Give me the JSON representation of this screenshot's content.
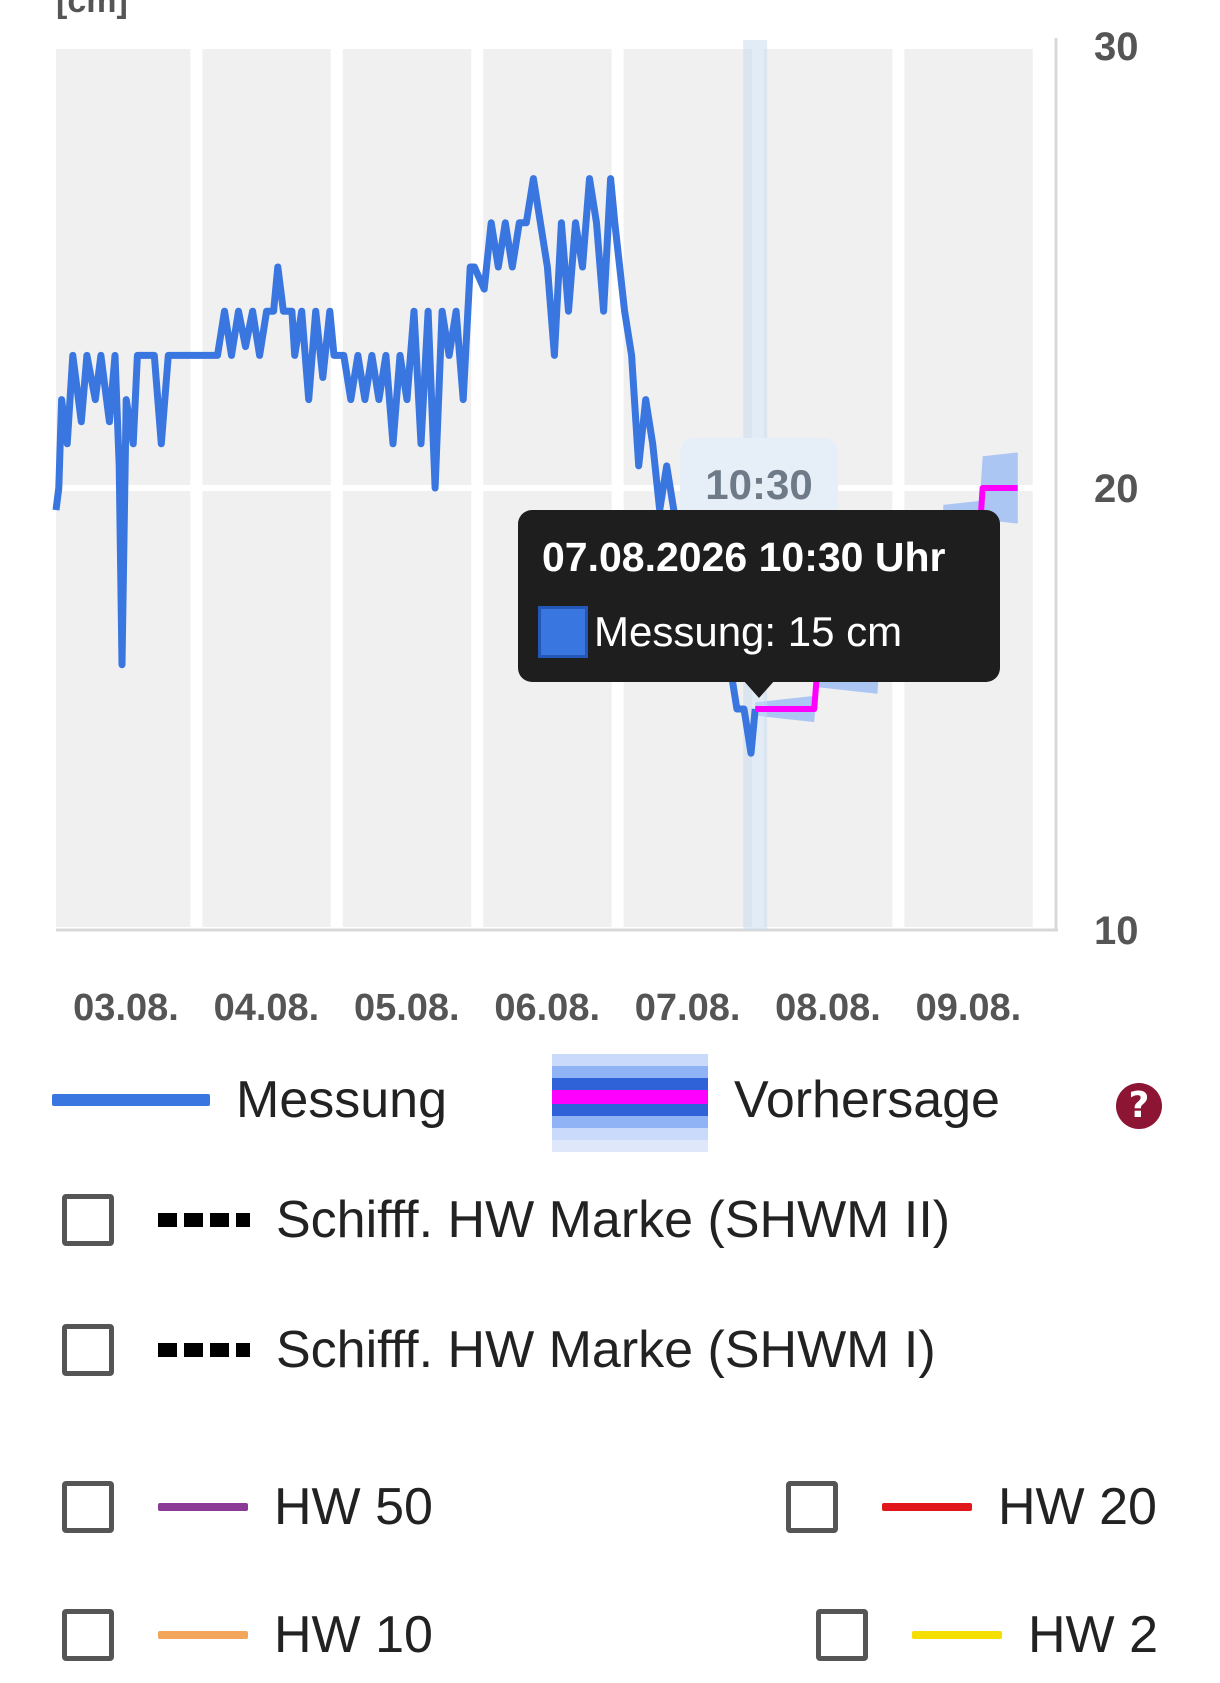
{
  "chart_data": {
    "type": "line",
    "ylabel": "[cm]",
    "ylim": [
      10,
      30
    ],
    "yticks": [
      "30",
      "20",
      "10"
    ],
    "x_range": [
      "03.08.",
      "10.08."
    ],
    "categories": [
      "03.08.",
      "04.08.",
      "05.08.",
      "06.08.",
      "07.08.",
      "08.08.",
      "09.08."
    ],
    "grid": true,
    "series": [
      {
        "name": "Messung",
        "color": "#3a76df",
        "points": [
          [
            0.0,
            19.5
          ],
          [
            0.02,
            20.0
          ],
          [
            0.04,
            22.0
          ],
          [
            0.08,
            21.0
          ],
          [
            0.12,
            23.0
          ],
          [
            0.18,
            21.5
          ],
          [
            0.22,
            23.0
          ],
          [
            0.28,
            22.0
          ],
          [
            0.32,
            23.0
          ],
          [
            0.38,
            21.5
          ],
          [
            0.42,
            23.0
          ],
          [
            0.45,
            20.5
          ],
          [
            0.47,
            16.0
          ],
          [
            0.5,
            22.0
          ],
          [
            0.55,
            21.0
          ],
          [
            0.58,
            23.0
          ],
          [
            0.65,
            23.0
          ],
          [
            0.7,
            23.0
          ],
          [
            0.75,
            21.0
          ],
          [
            0.8,
            23.0
          ],
          [
            0.85,
            23.0
          ],
          [
            0.95,
            23.0
          ],
          [
            0.98,
            23.0
          ],
          [
            1.05,
            23.0
          ],
          [
            1.15,
            23.0
          ],
          [
            1.2,
            24.0
          ],
          [
            1.25,
            23.0
          ],
          [
            1.3,
            24.0
          ],
          [
            1.35,
            23.2
          ],
          [
            1.4,
            24.0
          ],
          [
            1.45,
            23.0
          ],
          [
            1.5,
            24.0
          ],
          [
            1.55,
            24.0
          ],
          [
            1.58,
            25.0
          ],
          [
            1.62,
            24.0
          ],
          [
            1.68,
            24.0
          ],
          [
            1.7,
            23.0
          ],
          [
            1.75,
            24.0
          ],
          [
            1.8,
            22.0
          ],
          [
            1.85,
            24.0
          ],
          [
            1.9,
            22.5
          ],
          [
            1.95,
            24.0
          ],
          [
            1.98,
            23.0
          ],
          [
            2.05,
            23.0
          ],
          [
            2.1,
            22.0
          ],
          [
            2.15,
            23.0
          ],
          [
            2.2,
            22.0
          ],
          [
            2.25,
            23.0
          ],
          [
            2.3,
            22.0
          ],
          [
            2.35,
            23.0
          ],
          [
            2.4,
            21.0
          ],
          [
            2.45,
            23.0
          ],
          [
            2.5,
            22.0
          ],
          [
            2.55,
            24.0
          ],
          [
            2.6,
            21.0
          ],
          [
            2.65,
            24.0
          ],
          [
            2.7,
            20.0
          ],
          [
            2.75,
            24.0
          ],
          [
            2.8,
            23.0
          ],
          [
            2.85,
            24.0
          ],
          [
            2.9,
            22.0
          ],
          [
            2.95,
            25.0
          ],
          [
            2.98,
            25.0
          ],
          [
            3.05,
            24.5
          ],
          [
            3.1,
            26.0
          ],
          [
            3.15,
            25.0
          ],
          [
            3.2,
            26.0
          ],
          [
            3.25,
            25.0
          ],
          [
            3.3,
            26.0
          ],
          [
            3.35,
            26.0
          ],
          [
            3.4,
            27.0
          ],
          [
            3.45,
            26.0
          ],
          [
            3.5,
            25.0
          ],
          [
            3.55,
            23.0
          ],
          [
            3.6,
            26.0
          ],
          [
            3.65,
            24.0
          ],
          [
            3.7,
            26.0
          ],
          [
            3.75,
            25.0
          ],
          [
            3.8,
            27.0
          ],
          [
            3.85,
            26.0
          ],
          [
            3.9,
            24.0
          ],
          [
            3.95,
            27.0
          ],
          [
            3.98,
            26.0
          ],
          [
            4.05,
            24.0
          ],
          [
            4.1,
            23.0
          ],
          [
            4.15,
            20.5
          ],
          [
            4.2,
            22.0
          ],
          [
            4.25,
            21.0
          ],
          [
            4.3,
            19.5
          ],
          [
            4.35,
            20.5
          ],
          [
            4.4,
            19.5
          ],
          [
            4.45,
            19.0
          ],
          [
            4.5,
            18.0
          ],
          [
            4.55,
            17.5
          ],
          [
            4.6,
            17.0
          ],
          [
            4.65,
            17.5
          ],
          [
            4.7,
            16.5
          ],
          [
            4.75,
            16.0
          ],
          [
            4.8,
            16.0
          ],
          [
            4.85,
            15.0
          ],
          [
            4.9,
            15.0
          ],
          [
            4.95,
            14.0
          ],
          [
            4.98,
            15.0
          ]
        ]
      },
      {
        "name": "Vorhersage",
        "color": "#ff00ff",
        "points": [
          [
            4.98,
            15.0
          ],
          [
            5.4,
            15.0
          ],
          [
            5.42,
            15.8
          ],
          [
            5.85,
            15.8
          ],
          [
            5.88,
            17.0
          ],
          [
            6.3,
            17.0
          ],
          [
            6.32,
            19.0
          ],
          [
            6.58,
            19.0
          ],
          [
            6.6,
            20.0
          ],
          [
            6.85,
            20.0
          ]
        ]
      }
    ],
    "tooltip": {
      "cursor_label": "10:30",
      "title": "07.08.2026 10:30 Uhr",
      "entry": "Messung: 15 cm",
      "cursor_x": 4.98
    }
  },
  "legend": {
    "messung": "Messung",
    "vorhersage": "Vorhersage",
    "help_symbol": "?",
    "items": [
      {
        "label": "Schifff. HW Marke (SHWM II)"
      },
      {
        "label": "Schifff. HW Marke (SHWM I)"
      },
      {
        "label": "HW 50",
        "color": "#8b3a96"
      },
      {
        "label": "HW 20",
        "color": "#e0161b"
      },
      {
        "label": "HW 10",
        "color": "#f3a55c"
      },
      {
        "label": "HW 2",
        "color": "#f5df00"
      }
    ]
  }
}
